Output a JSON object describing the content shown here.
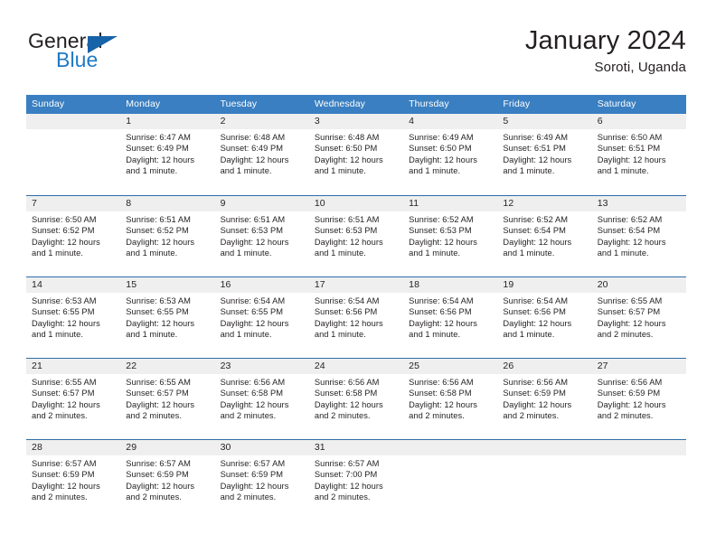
{
  "brand": {
    "name_part1": "General",
    "name_part2": "Blue",
    "logo_icon": "blue-triangle-flag-icon"
  },
  "header": {
    "title": "January 2024",
    "subtitle": "Soroti, Uganda"
  },
  "colors": {
    "header_blue": "#3a7fc1",
    "row_divider_blue": "#2e6da8",
    "day_band_gray": "#efefef",
    "brand_blue": "#1f7ac4",
    "text": "#231f20"
  },
  "calendar": {
    "weekdays": [
      "Sunday",
      "Monday",
      "Tuesday",
      "Wednesday",
      "Thursday",
      "Friday",
      "Saturday"
    ],
    "labels": {
      "sunrise": "Sunrise:",
      "sunset": "Sunset:",
      "daylight": "Daylight:"
    },
    "weeks": [
      [
        {
          "day": "",
          "sunrise": "",
          "sunset": "",
          "daylight_line1": "",
          "daylight_line2": "",
          "empty": true
        },
        {
          "day": "1",
          "sunrise": "Sunrise: 6:47 AM",
          "sunset": "Sunset: 6:49 PM",
          "daylight_line1": "Daylight: 12 hours",
          "daylight_line2": "and 1 minute.",
          "empty": false
        },
        {
          "day": "2",
          "sunrise": "Sunrise: 6:48 AM",
          "sunset": "Sunset: 6:49 PM",
          "daylight_line1": "Daylight: 12 hours",
          "daylight_line2": "and 1 minute.",
          "empty": false
        },
        {
          "day": "3",
          "sunrise": "Sunrise: 6:48 AM",
          "sunset": "Sunset: 6:50 PM",
          "daylight_line1": "Daylight: 12 hours",
          "daylight_line2": "and 1 minute.",
          "empty": false
        },
        {
          "day": "4",
          "sunrise": "Sunrise: 6:49 AM",
          "sunset": "Sunset: 6:50 PM",
          "daylight_line1": "Daylight: 12 hours",
          "daylight_line2": "and 1 minute.",
          "empty": false
        },
        {
          "day": "5",
          "sunrise": "Sunrise: 6:49 AM",
          "sunset": "Sunset: 6:51 PM",
          "daylight_line1": "Daylight: 12 hours",
          "daylight_line2": "and 1 minute.",
          "empty": false
        },
        {
          "day": "6",
          "sunrise": "Sunrise: 6:50 AM",
          "sunset": "Sunset: 6:51 PM",
          "daylight_line1": "Daylight: 12 hours",
          "daylight_line2": "and 1 minute.",
          "empty": false
        }
      ],
      [
        {
          "day": "7",
          "sunrise": "Sunrise: 6:50 AM",
          "sunset": "Sunset: 6:52 PM",
          "daylight_line1": "Daylight: 12 hours",
          "daylight_line2": "and 1 minute.",
          "empty": false
        },
        {
          "day": "8",
          "sunrise": "Sunrise: 6:51 AM",
          "sunset": "Sunset: 6:52 PM",
          "daylight_line1": "Daylight: 12 hours",
          "daylight_line2": "and 1 minute.",
          "empty": false
        },
        {
          "day": "9",
          "sunrise": "Sunrise: 6:51 AM",
          "sunset": "Sunset: 6:53 PM",
          "daylight_line1": "Daylight: 12 hours",
          "daylight_line2": "and 1 minute.",
          "empty": false
        },
        {
          "day": "10",
          "sunrise": "Sunrise: 6:51 AM",
          "sunset": "Sunset: 6:53 PM",
          "daylight_line1": "Daylight: 12 hours",
          "daylight_line2": "and 1 minute.",
          "empty": false
        },
        {
          "day": "11",
          "sunrise": "Sunrise: 6:52 AM",
          "sunset": "Sunset: 6:53 PM",
          "daylight_line1": "Daylight: 12 hours",
          "daylight_line2": "and 1 minute.",
          "empty": false
        },
        {
          "day": "12",
          "sunrise": "Sunrise: 6:52 AM",
          "sunset": "Sunset: 6:54 PM",
          "daylight_line1": "Daylight: 12 hours",
          "daylight_line2": "and 1 minute.",
          "empty": false
        },
        {
          "day": "13",
          "sunrise": "Sunrise: 6:52 AM",
          "sunset": "Sunset: 6:54 PM",
          "daylight_line1": "Daylight: 12 hours",
          "daylight_line2": "and 1 minute.",
          "empty": false
        }
      ],
      [
        {
          "day": "14",
          "sunrise": "Sunrise: 6:53 AM",
          "sunset": "Sunset: 6:55 PM",
          "daylight_line1": "Daylight: 12 hours",
          "daylight_line2": "and 1 minute.",
          "empty": false
        },
        {
          "day": "15",
          "sunrise": "Sunrise: 6:53 AM",
          "sunset": "Sunset: 6:55 PM",
          "daylight_line1": "Daylight: 12 hours",
          "daylight_line2": "and 1 minute.",
          "empty": false
        },
        {
          "day": "16",
          "sunrise": "Sunrise: 6:54 AM",
          "sunset": "Sunset: 6:55 PM",
          "daylight_line1": "Daylight: 12 hours",
          "daylight_line2": "and 1 minute.",
          "empty": false
        },
        {
          "day": "17",
          "sunrise": "Sunrise: 6:54 AM",
          "sunset": "Sunset: 6:56 PM",
          "daylight_line1": "Daylight: 12 hours",
          "daylight_line2": "and 1 minute.",
          "empty": false
        },
        {
          "day": "18",
          "sunrise": "Sunrise: 6:54 AM",
          "sunset": "Sunset: 6:56 PM",
          "daylight_line1": "Daylight: 12 hours",
          "daylight_line2": "and 1 minute.",
          "empty": false
        },
        {
          "day": "19",
          "sunrise": "Sunrise: 6:54 AM",
          "sunset": "Sunset: 6:56 PM",
          "daylight_line1": "Daylight: 12 hours",
          "daylight_line2": "and 1 minute.",
          "empty": false
        },
        {
          "day": "20",
          "sunrise": "Sunrise: 6:55 AM",
          "sunset": "Sunset: 6:57 PM",
          "daylight_line1": "Daylight: 12 hours",
          "daylight_line2": "and 2 minutes.",
          "empty": false
        }
      ],
      [
        {
          "day": "21",
          "sunrise": "Sunrise: 6:55 AM",
          "sunset": "Sunset: 6:57 PM",
          "daylight_line1": "Daylight: 12 hours",
          "daylight_line2": "and 2 minutes.",
          "empty": false
        },
        {
          "day": "22",
          "sunrise": "Sunrise: 6:55 AM",
          "sunset": "Sunset: 6:57 PM",
          "daylight_line1": "Daylight: 12 hours",
          "daylight_line2": "and 2 minutes.",
          "empty": false
        },
        {
          "day": "23",
          "sunrise": "Sunrise: 6:56 AM",
          "sunset": "Sunset: 6:58 PM",
          "daylight_line1": "Daylight: 12 hours",
          "daylight_line2": "and 2 minutes.",
          "empty": false
        },
        {
          "day": "24",
          "sunrise": "Sunrise: 6:56 AM",
          "sunset": "Sunset: 6:58 PM",
          "daylight_line1": "Daylight: 12 hours",
          "daylight_line2": "and 2 minutes.",
          "empty": false
        },
        {
          "day": "25",
          "sunrise": "Sunrise: 6:56 AM",
          "sunset": "Sunset: 6:58 PM",
          "daylight_line1": "Daylight: 12 hours",
          "daylight_line2": "and 2 minutes.",
          "empty": false
        },
        {
          "day": "26",
          "sunrise": "Sunrise: 6:56 AM",
          "sunset": "Sunset: 6:59 PM",
          "daylight_line1": "Daylight: 12 hours",
          "daylight_line2": "and 2 minutes.",
          "empty": false
        },
        {
          "day": "27",
          "sunrise": "Sunrise: 6:56 AM",
          "sunset": "Sunset: 6:59 PM",
          "daylight_line1": "Daylight: 12 hours",
          "daylight_line2": "and 2 minutes.",
          "empty": false
        }
      ],
      [
        {
          "day": "28",
          "sunrise": "Sunrise: 6:57 AM",
          "sunset": "Sunset: 6:59 PM",
          "daylight_line1": "Daylight: 12 hours",
          "daylight_line2": "and 2 minutes.",
          "empty": false
        },
        {
          "day": "29",
          "sunrise": "Sunrise: 6:57 AM",
          "sunset": "Sunset: 6:59 PM",
          "daylight_line1": "Daylight: 12 hours",
          "daylight_line2": "and 2 minutes.",
          "empty": false
        },
        {
          "day": "30",
          "sunrise": "Sunrise: 6:57 AM",
          "sunset": "Sunset: 6:59 PM",
          "daylight_line1": "Daylight: 12 hours",
          "daylight_line2": "and 2 minutes.",
          "empty": false
        },
        {
          "day": "31",
          "sunrise": "Sunrise: 6:57 AM",
          "sunset": "Sunset: 7:00 PM",
          "daylight_line1": "Daylight: 12 hours",
          "daylight_line2": "and 2 minutes.",
          "empty": false
        },
        {
          "day": "",
          "sunrise": "",
          "sunset": "",
          "daylight_line1": "",
          "daylight_line2": "",
          "empty": true
        },
        {
          "day": "",
          "sunrise": "",
          "sunset": "",
          "daylight_line1": "",
          "daylight_line2": "",
          "empty": true
        },
        {
          "day": "",
          "sunrise": "",
          "sunset": "",
          "daylight_line1": "",
          "daylight_line2": "",
          "empty": true
        }
      ]
    ]
  }
}
